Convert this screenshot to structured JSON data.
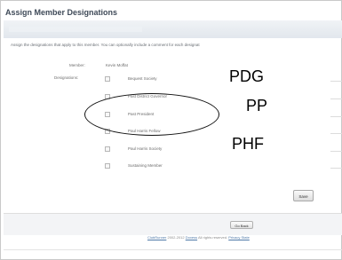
{
  "page": {
    "title": "Assign Member Designations",
    "instruction": "Assign the designations that apply to this member. You can optionally include a comment for each designat"
  },
  "form": {
    "member_label": "Member:",
    "member_value": "Kevin Moffat",
    "designations_label": "Designations:",
    "designations": [
      {
        "label": "Bequest Society",
        "checked": false
      },
      {
        "label": "Past District Governor",
        "checked": false
      },
      {
        "label": "Past President",
        "checked": false
      },
      {
        "label": "Paul Harris Fellow",
        "checked": false
      },
      {
        "label": "Paul Harris Society",
        "checked": false
      },
      {
        "label": "Sustaining Member",
        "checked": false
      }
    ],
    "save_label": "Save"
  },
  "annotations": {
    "pdg": "PDG",
    "pp": "PP",
    "phf": "PHF"
  },
  "footer": {
    "go_back_label": "Go Back",
    "product_link": "ClubRunner",
    "years": "2002-2012",
    "company_link": "Doxess",
    "rights": "All rights reserved.",
    "privacy_link": "Privacy State"
  }
}
